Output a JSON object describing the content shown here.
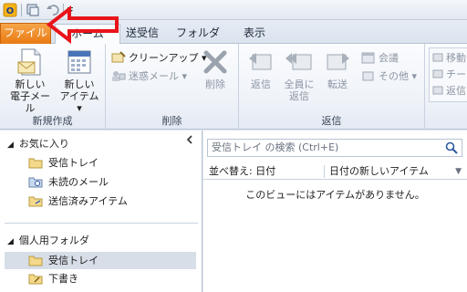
{
  "tabs": {
    "file": "ファイル",
    "home": "ホーム",
    "sendreceive": "送受信",
    "folder": "フォルダー",
    "view": "表示"
  },
  "ribbon": {
    "new_email": "新しい\n電子メール",
    "new_email_l1": "新しい",
    "new_email_l2": "電子メール",
    "new_items_l1": "新しい",
    "new_items_l2": "アイテム ▾",
    "group_new": "新規作成",
    "cleanup": "クリーンアップ ▾",
    "junk": "迷惑メール ▾",
    "delete": "削除",
    "group_delete": "削除",
    "reply": "返信",
    "reply_all_l1": "全員に",
    "reply_all_l2": "返信",
    "forward": "転送",
    "meeting": "会議",
    "more": "その他 ▾",
    "group_respond": "返信",
    "move": "移動",
    "team": "チー",
    "done": "返信"
  },
  "nav": {
    "favorites": "お気に入り",
    "fav_inbox": "受信トレイ",
    "fav_unread": "未読のメール",
    "fav_sent": "送信済みアイテム",
    "personal": "個人用フォルダ",
    "p_inbox": "受信トレイ",
    "p_drafts": "下書き"
  },
  "content": {
    "search_placeholder": "受信トレイ の検索 (Ctrl+E)",
    "sort_by": "並べ替え: 日付",
    "sort_order": "日付の新しいアイテム",
    "empty_message": "このビューにはアイテムがありません。"
  },
  "colors": {
    "file_tab": "#e97a12",
    "annotation_arrow": "#e8141b"
  }
}
